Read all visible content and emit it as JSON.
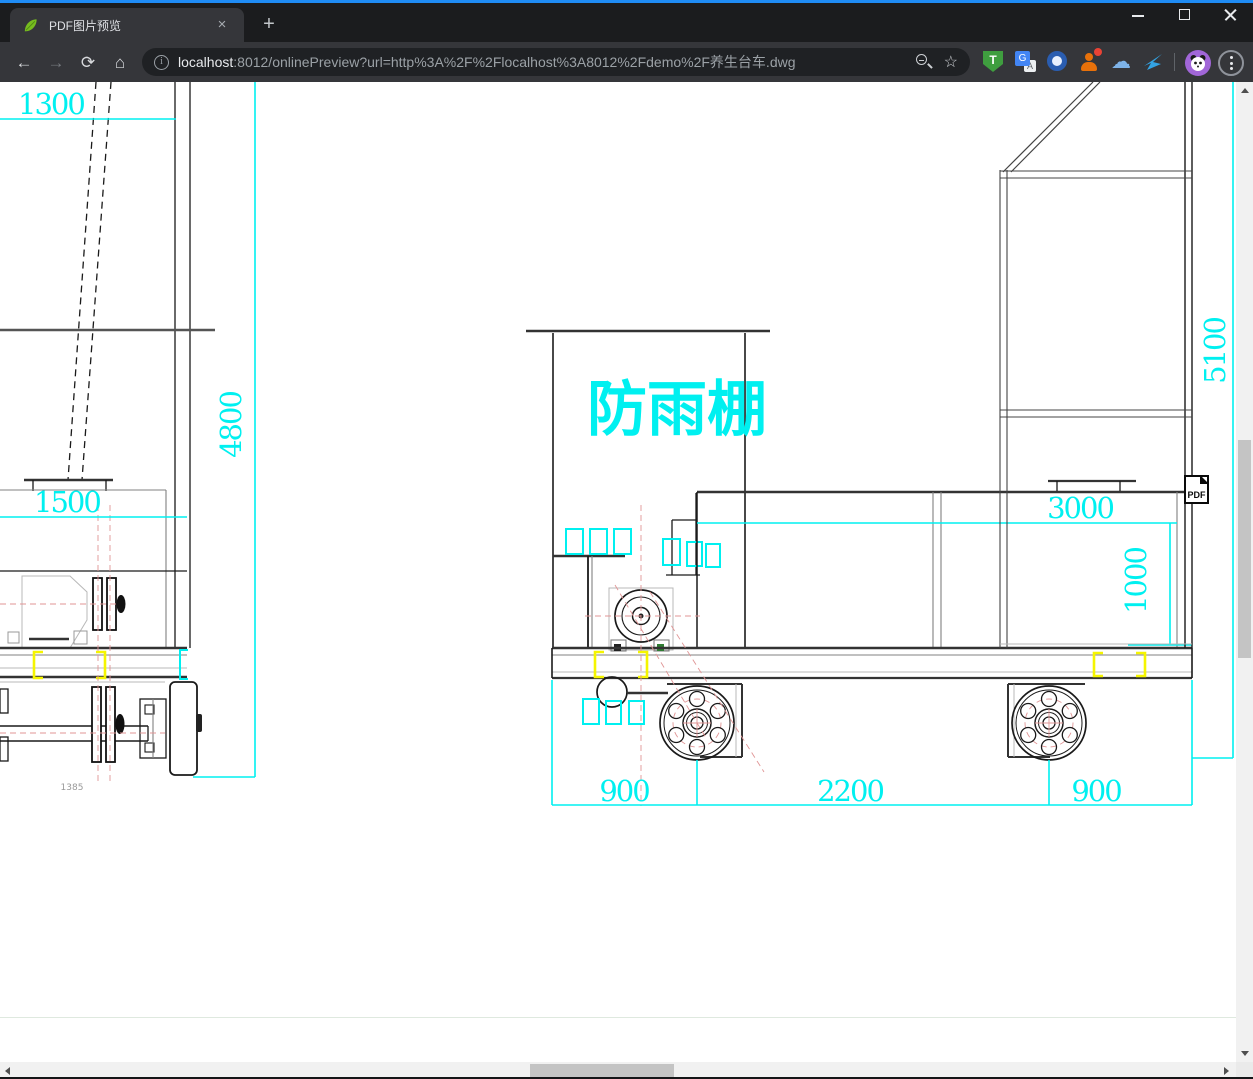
{
  "browser": {
    "tab": {
      "title": "PDF图片预览"
    },
    "address": {
      "host": "localhost",
      "path": ":8012/onlinePreview?url=http%3A%2F%2Flocalhost%3A8012%2Fdemo%2F养生台车.dwg"
    },
    "extensions": {
      "tampermonkey_letter": "T",
      "translate_letter_primary": "G",
      "translate_letter_secondary": "A"
    }
  },
  "icons": {
    "back": "←",
    "forward": "→",
    "reload": "⟳",
    "home": "⌂",
    "page_info": "i",
    "star": "☆",
    "cloud": "☁",
    "tab_close": "×",
    "new_tab": "+"
  },
  "drawing": {
    "shelter_label": "防雨棚",
    "pdf_badge": "PDF",
    "dims": {
      "top_left_width": "1300",
      "left_height": "4800",
      "left_inner_width": "1500",
      "left_minor_width": "1385",
      "platform_length": "3000",
      "platform_height": "1000",
      "right_height": "5100",
      "wheelbase_left": "900",
      "wheelbase_center": "2200",
      "wheelbase_right": "900"
    },
    "colors": {
      "dimension": "#00F0F0",
      "highlight": "#F5F500",
      "centerline": "#E09595",
      "line": "#1a1a1a"
    }
  }
}
